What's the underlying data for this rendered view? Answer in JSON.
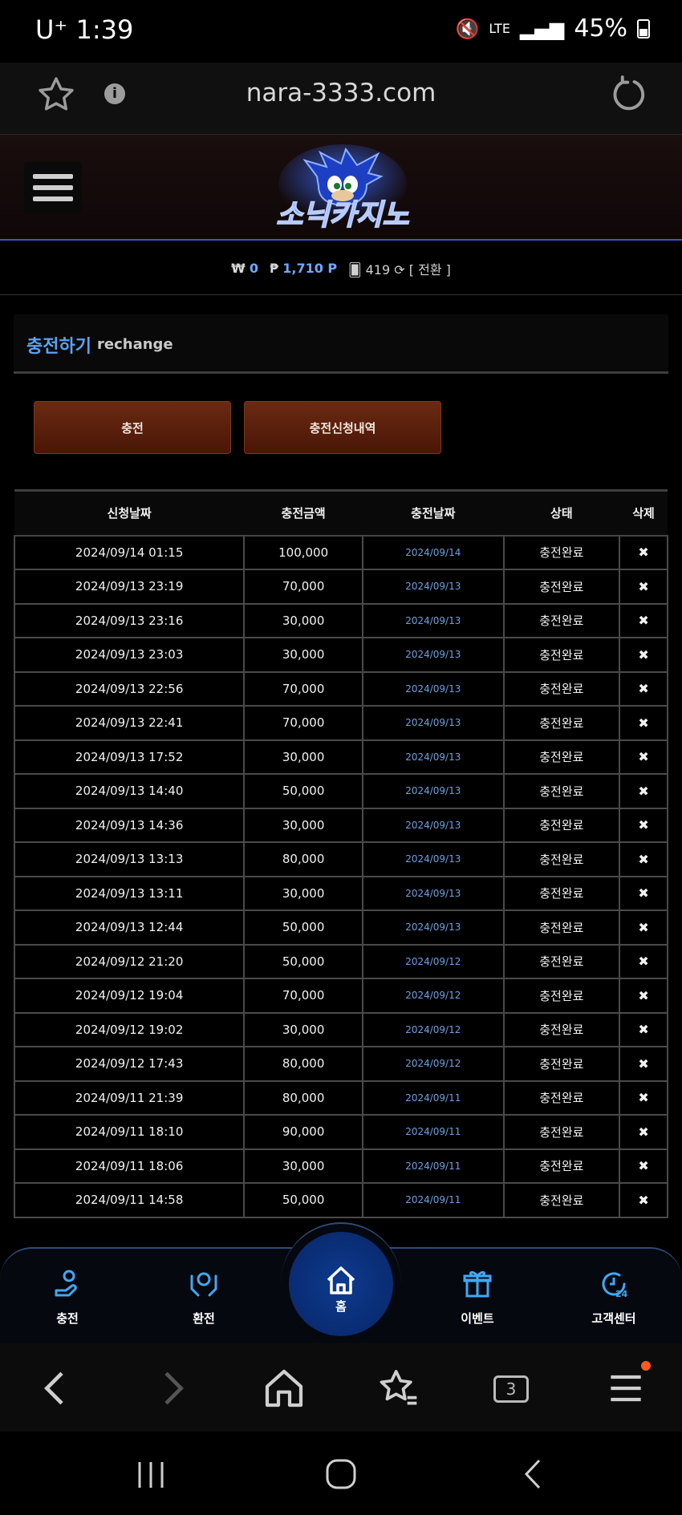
{
  "status": {
    "carrier_time": "U⁺ 1:39",
    "network": "LTE",
    "battery": "45%"
  },
  "browser": {
    "url": "nara-3333.com",
    "info_glyph": "i"
  },
  "header": {
    "logo": "소닉카지노"
  },
  "wallet": {
    "won_symbol": "₩",
    "won_value": "0",
    "point_symbol": "₱",
    "point_value": "1,710 P",
    "chip_value": "419",
    "convert": "[ 전환 ]"
  },
  "panel": {
    "title": "충전하기",
    "subtitle": "rechange"
  },
  "buttons": {
    "charge": "충전",
    "history": "충전신청내역"
  },
  "table": {
    "headers": [
      "신청날짜",
      "충전금액",
      "충전날짜",
      "상태",
      "삭제"
    ],
    "rows": [
      [
        "2024/09/14 01:15",
        "100,000",
        "2024/09/14",
        "충전완료",
        "✖"
      ],
      [
        "2024/09/13 23:19",
        "70,000",
        "2024/09/13",
        "충전완료",
        "✖"
      ],
      [
        "2024/09/13 23:16",
        "30,000",
        "2024/09/13",
        "충전완료",
        "✖"
      ],
      [
        "2024/09/13 23:03",
        "30,000",
        "2024/09/13",
        "충전완료",
        "✖"
      ],
      [
        "2024/09/13 22:56",
        "70,000",
        "2024/09/13",
        "충전완료",
        "✖"
      ],
      [
        "2024/09/13 22:41",
        "70,000",
        "2024/09/13",
        "충전완료",
        "✖"
      ],
      [
        "2024/09/13 17:52",
        "30,000",
        "2024/09/13",
        "충전완료",
        "✖"
      ],
      [
        "2024/09/13 14:40",
        "50,000",
        "2024/09/13",
        "충전완료",
        "✖"
      ],
      [
        "2024/09/13 14:36",
        "30,000",
        "2024/09/13",
        "충전완료",
        "✖"
      ],
      [
        "2024/09/13 13:13",
        "80,000",
        "2024/09/13",
        "충전완료",
        "✖"
      ],
      [
        "2024/09/13 13:11",
        "30,000",
        "2024/09/13",
        "충전완료",
        "✖"
      ],
      [
        "2024/09/13 12:44",
        "50,000",
        "2024/09/13",
        "충전완료",
        "✖"
      ],
      [
        "2024/09/12 21:20",
        "50,000",
        "2024/09/12",
        "충전완료",
        "✖"
      ],
      [
        "2024/09/12 19:04",
        "70,000",
        "2024/09/12",
        "충전완료",
        "✖"
      ],
      [
        "2024/09/12 19:02",
        "30,000",
        "2024/09/12",
        "충전완료",
        "✖"
      ],
      [
        "2024/09/12 17:43",
        "80,000",
        "2024/09/12",
        "충전완료",
        "✖"
      ],
      [
        "2024/09/11 21:39",
        "80,000",
        "2024/09/11",
        "충전완료",
        "✖"
      ],
      [
        "2024/09/11 18:10",
        "90,000",
        "2024/09/11",
        "충전완료",
        "✖"
      ],
      [
        "2024/09/11 18:06",
        "30,000",
        "2024/09/11",
        "충전완료",
        "✖"
      ],
      [
        "2024/09/11 14:58",
        "50,000",
        "2024/09/11",
        "충전완료",
        "✖"
      ]
    ]
  },
  "bottom_nav": {
    "charge": "충전",
    "exchange": "환전",
    "home": "홈",
    "event": "이벤트",
    "support": "고객센터"
  },
  "browser_nav": {
    "tabs_count": "3"
  },
  "colors": {
    "accent_blue": "#5aa3f0",
    "button_brown": "#5a1f0a",
    "home_blue": "#0d3b8f",
    "notify_dot": "#ff5a1f"
  }
}
